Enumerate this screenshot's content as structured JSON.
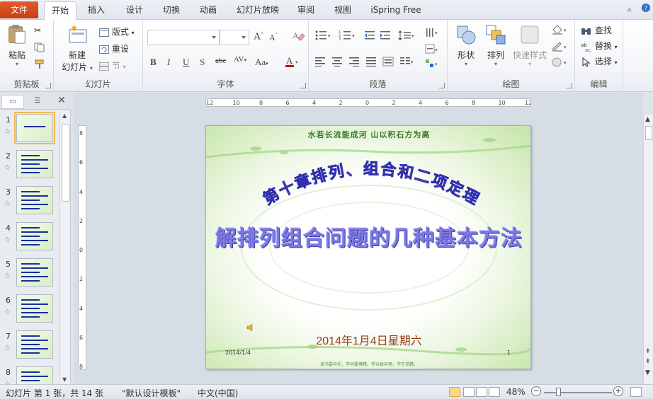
{
  "tabs": {
    "file": "文件",
    "items": [
      "开始",
      "插入",
      "设计",
      "切换",
      "动画",
      "幻灯片放映",
      "审阅",
      "视图",
      "iSpring Free"
    ],
    "active_index": 0
  },
  "ribbon": {
    "clipboard": {
      "label": "剪贴板",
      "paste": "粘贴"
    },
    "slides": {
      "label": "幻灯片",
      "new_slide_line1": "新建",
      "new_slide_line2": "幻灯片",
      "layout": "版式",
      "reset": "重设",
      "section": "节"
    },
    "font": {
      "label": "字体",
      "font_name": "",
      "font_size": ""
    },
    "paragraph": {
      "label": "段落"
    },
    "drawing": {
      "label": "绘图",
      "shapes": "形状",
      "arrange": "排列",
      "quick_styles": "快速样式"
    },
    "editing": {
      "label": "编辑",
      "find": "查找",
      "replace": "替换",
      "select": "选择"
    }
  },
  "thumbnails": [
    {
      "num": "1"
    },
    {
      "num": "2"
    },
    {
      "num": "3"
    },
    {
      "num": "4"
    },
    {
      "num": "5"
    },
    {
      "num": "6"
    },
    {
      "num": "7"
    },
    {
      "num": "8"
    }
  ],
  "ruler": {
    "horizontal": [
      "12",
      "10",
      "8",
      "6",
      "4",
      "2",
      "0",
      "2",
      "4",
      "6",
      "8",
      "10",
      "12"
    ],
    "vertical": [
      "8",
      "6",
      "4",
      "2",
      "0",
      "2",
      "4",
      "6",
      "8"
    ]
  },
  "slide": {
    "top_text": "水若长流能成河  山以积石方为高",
    "title": "第十章排列、组合和二项定理",
    "subtitle": "解排列组合问题的几种基本方法",
    "date": "2014年1月4日星期六",
    "footer_date": "2014/1/4",
    "page_number": "1",
    "bottom_text": "读书要中外，学问要博精，学以致中用，学于求精。"
  },
  "statusbar": {
    "slide_info": "幻灯片 第 1 张，共 14 张",
    "theme": "\"默认设计模板\"",
    "language": "中文(中国)",
    "zoom": "48%",
    "zoom_percent": 48
  },
  "colors": {
    "file_tab": "#d24a1c",
    "title_arc": "#2f2fb0",
    "title_arc_fill": "#c89a1a",
    "subtitle": "#7b78e0",
    "date": "#9a3c1a"
  }
}
